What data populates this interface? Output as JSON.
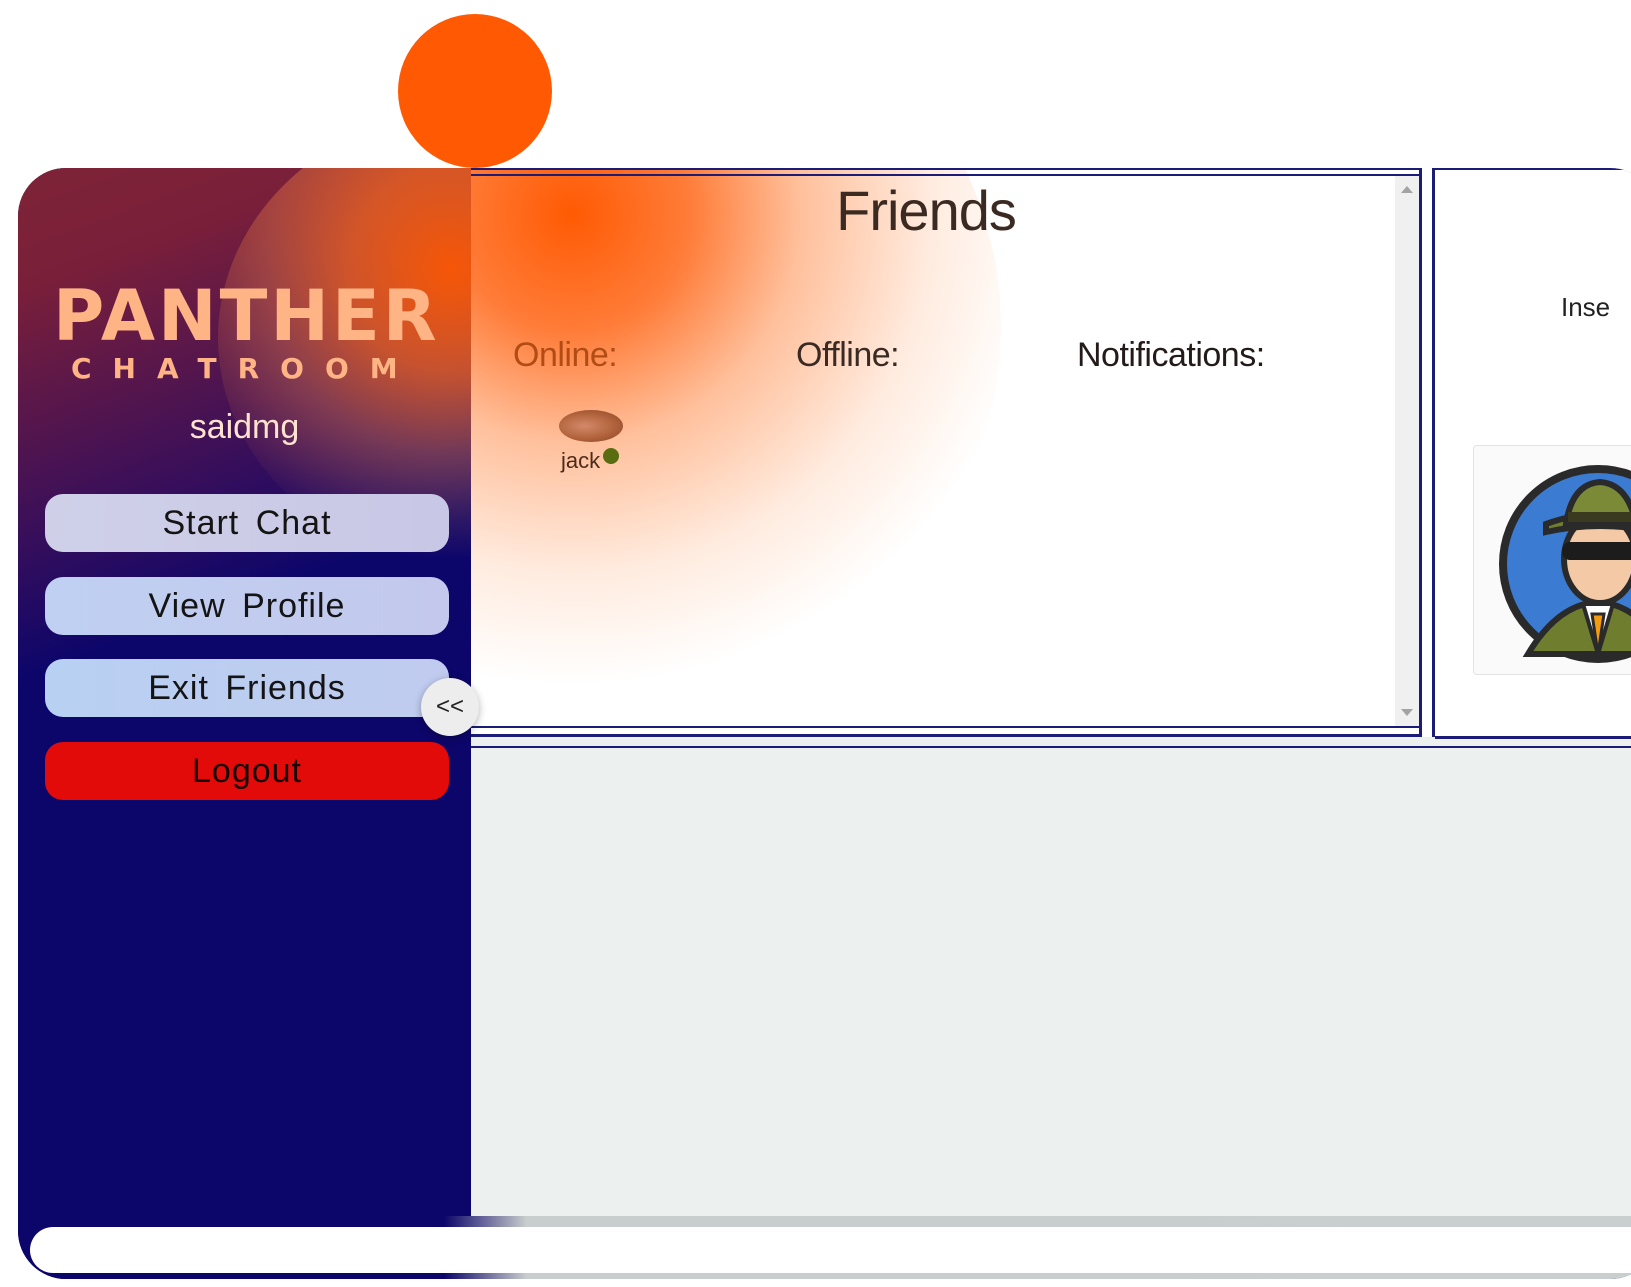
{
  "app": {
    "logo_main": "PANTHER",
    "logo_sub": "CHATROOM",
    "username": "saidmg"
  },
  "sidebar": {
    "buttons": [
      {
        "label": "Start Chat"
      },
      {
        "label": "View Profile"
      },
      {
        "label": "Exit Friends"
      },
      {
        "label": "Logout"
      }
    ],
    "collapse_label": "<<"
  },
  "friends_panel": {
    "title": "Friends",
    "columns": {
      "online": "Online:",
      "offline": "Offline:",
      "notifications": "Notifications:"
    },
    "online_friends": [
      {
        "name": "jack",
        "status": "online"
      }
    ]
  },
  "right_panel": {
    "label": "Inse",
    "avatar_icon": "detective-avatar-icon"
  },
  "composer": {
    "value": "",
    "placeholder": ""
  },
  "colors": {
    "accent_orange": "#ff5a03",
    "sidebar_navy": "#0d066a",
    "logout_red": "#e30a0a",
    "online_dot": "#586d10",
    "logo_peach": "#ffb485"
  }
}
